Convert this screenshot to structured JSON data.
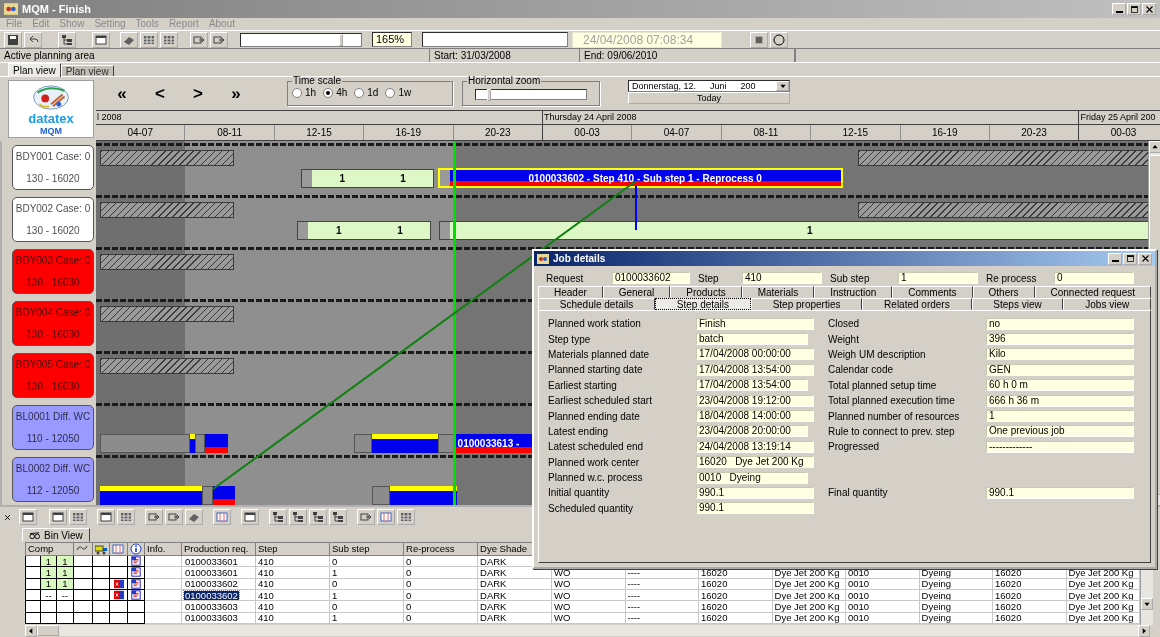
{
  "window": {
    "title": "MQM - Finish"
  },
  "menu": [
    "File",
    "Edit",
    "Show",
    "Setting",
    "Tools",
    "Report",
    "About"
  ],
  "toolbar": {
    "zoom_slider": {
      "level": 0.82
    },
    "zoom": "165%",
    "clock": "24/04/2008 07:08:34"
  },
  "info_bar": {
    "area": "Active planning area",
    "start": "Start: 31/03/2008",
    "end": "End: 09/06/2010"
  },
  "tabs": [
    {
      "label": "Plan view",
      "selected": true
    },
    {
      "label": "Plan view",
      "selected": false
    }
  ],
  "logo": {
    "name": "datatex",
    "product": "MQM"
  },
  "nav_buttons": [
    "«",
    "<",
    ">",
    "»"
  ],
  "time_scale": {
    "title": "Time scale",
    "options": [
      {
        "label": "1h",
        "selected": false
      },
      {
        "label": "4h",
        "selected": true
      },
      {
        "label": "1d",
        "selected": false
      },
      {
        "label": "1w",
        "selected": false
      }
    ]
  },
  "horizontal_zoom": {
    "title": "Horizontal zoom",
    "level": 0.1
  },
  "date_picker": {
    "parts": [
      "Donnerstag, 12.",
      "Juni",
      "200"
    ]
  },
  "today_button": "Today",
  "timeline": {
    "days": [
      {
        "label": "l 2008",
        "slots": [
          "04-07",
          "08-11",
          "12-15",
          "16-19",
          "20-23"
        ]
      },
      {
        "label": "Thursday 24 April 2008",
        "slots": [
          "00-03",
          "04-07",
          "08-11",
          "12-15",
          "16-19",
          "20-23"
        ]
      },
      {
        "label": "Friday 25 April 200",
        "slots": [
          "00-03"
        ]
      }
    ]
  },
  "resources": [
    {
      "name": "BDY001 Case: 0",
      "code": "130 - 16020",
      "color": "#ffffff",
      "bars": [
        {
          "kind": "hatch"
        },
        {
          "kind": "job",
          "labels": [
            "1",
            "1"
          ]
        },
        {
          "kind": "selected",
          "labels": [
            "0100033602 - Step 410 - Sub step 1 - Reprocess 0"
          ]
        },
        {
          "kind": "hatch"
        }
      ]
    },
    {
      "name": "BDY002 Case: 0",
      "code": "130 - 16020",
      "color": "#ffffff",
      "bars": [
        {
          "kind": "hatch"
        },
        {
          "kind": "job",
          "labels": [
            "1",
            "1"
          ]
        },
        {
          "kind": "job",
          "labels": [
            "1"
          ]
        },
        {
          "kind": "hatch"
        }
      ]
    },
    {
      "name": "BDY003 Case: 0",
      "code": "130 - 16030",
      "color": "#ff0000",
      "bars": [
        {
          "kind": "hatch"
        }
      ]
    },
    {
      "name": "BDY004 Case: 0",
      "code": "130 - 16030",
      "color": "#ff0000",
      "bars": [
        {
          "kind": "hatch"
        }
      ]
    },
    {
      "name": "BDY005 Case: 0",
      "code": "130 - 16030",
      "color": "#ff0000",
      "bars": [
        {
          "kind": "hatch"
        }
      ]
    },
    {
      "name": "BL0001 Diff. WC",
      "code": "110 - 12050",
      "color": "#9999ff",
      "bars": [
        {
          "kind": "idle"
        },
        {
          "kind": "run"
        },
        {
          "kind": "idle"
        },
        {
          "kind": "done"
        },
        {
          "kind": "idle"
        },
        {
          "kind": "run"
        },
        {
          "kind": "idle"
        },
        {
          "kind": "done",
          "labels": [
            "0100033613 -"
          ]
        }
      ]
    },
    {
      "name": "BL0002 Diff. WC",
      "code": "112 - 12050",
      "color": "#9999ff",
      "bars": [
        {
          "kind": "run"
        },
        {
          "kind": "idle"
        },
        {
          "kind": "done"
        },
        {
          "kind": "idle"
        },
        {
          "kind": "run"
        }
      ]
    }
  ],
  "bin_view": {
    "tab": "Bin View",
    "comp_header": "Comp",
    "info_header": "Info.",
    "columns": [
      "Production req.",
      "Step",
      "Sub step",
      "Re-process",
      "Dye Shade"
    ],
    "rows": [
      {
        "comp": [
          "1",
          "1"
        ],
        "complete": true,
        "marked": false,
        "noted": true,
        "selected": false,
        "cells": [
          "0100033601",
          "410",
          "0",
          "0",
          "DARK"
        ]
      },
      {
        "comp": [
          "1",
          "1"
        ],
        "complete": true,
        "marked": false,
        "noted": true,
        "selected": false,
        "cells": [
          "0100033601",
          "410",
          "1",
          "0",
          "DARK",
          "WO",
          "----",
          "16020",
          "Dye Jet 200 Kg",
          "0010",
          "Dyeing",
          "16020",
          "Dye Jet 200 Kg"
        ]
      },
      {
        "comp": [
          "1",
          "1"
        ],
        "complete": true,
        "marked": true,
        "noted": true,
        "selected": false,
        "cells": [
          "0100033602",
          "410",
          "0",
          "0",
          "DARK",
          "WO",
          "----",
          "16020",
          "Dye Jet 200 Kg",
          "0010",
          "Dyeing",
          "16020",
          "Dye Jet 200 Kg"
        ]
      },
      {
        "comp": [
          "--",
          "--"
        ],
        "complete": false,
        "marked": true,
        "noted": true,
        "selected": true,
        "cells": [
          "0100033602",
          "410",
          "1",
          "0",
          "DARK",
          "WO",
          "----",
          "16020",
          "Dye Jet 200 Kg",
          "0010",
          "Dyeing",
          "16020",
          "Dye Jet 200 Kg"
        ]
      },
      {
        "complete": false,
        "marked": false,
        "noted": false,
        "selected": false,
        "cells": [
          "0100033603",
          "410",
          "0",
          "0",
          "DARK",
          "WO",
          "----",
          "16020",
          "Dye Jet 200 Kg",
          "0010",
          "Dyeing",
          "16020",
          "Dye Jet 200 Kg"
        ]
      },
      {
        "complete": false,
        "marked": false,
        "noted": false,
        "selected": false,
        "cells": [
          "0100033603",
          "410",
          "1",
          "0",
          "DARK",
          "WO",
          "----",
          "16020",
          "Dye Jet 200 Kg",
          "0010",
          "Dyeing",
          "16020",
          "Dye Jet 200 Kg"
        ]
      }
    ]
  },
  "job_details": {
    "title": "Job details",
    "header": [
      {
        "label": "Request",
        "value": "0100033602"
      },
      {
        "label": "Step",
        "value": "410"
      },
      {
        "label": "Sub step",
        "value": "1"
      },
      {
        "label": "Re process",
        "value": "0"
      }
    ],
    "tab_rows": [
      [
        {
          "label": "Header",
          "selected": false
        },
        {
          "label": "General",
          "selected": false
        },
        {
          "label": "Products",
          "selected": false
        },
        {
          "label": "Materials",
          "selected": false
        },
        {
          "label": "Instruction",
          "selected": false
        },
        {
          "label": "Comments",
          "selected": false
        },
        {
          "label": "Others",
          "selected": false
        },
        {
          "label": "Connected request",
          "selected": false
        }
      ],
      [
        {
          "label": "Schedule details",
          "selected": false
        },
        {
          "label": "Step details",
          "selected": true
        },
        {
          "label": "Step properties",
          "selected": false
        },
        {
          "label": "Related orders",
          "selected": false
        },
        {
          "label": "Steps view",
          "selected": false
        },
        {
          "label": "Jobs view",
          "selected": false
        }
      ]
    ],
    "fields": [
      {
        "left": {
          "label": "Planned work station",
          "value": "Finish"
        },
        "right": {
          "label": "Closed",
          "value": "no"
        }
      },
      {
        "left": {
          "label": "Step type",
          "value": "batch"
        },
        "right": {
          "label": "Weight",
          "value": "396"
        }
      },
      {
        "left": {
          "label": "Materials planned date",
          "value": "17/04/2008 00:00:00"
        },
        "right": {
          "label": "Weigh UM description",
          "value": "Kilo"
        }
      },
      {
        "left": {
          "label": "Planned starting date",
          "value": "17/04/2008 13:54:00"
        },
        "right": {
          "label": "Calendar code",
          "value": "GEN"
        }
      },
      {
        "left": {
          "label": "Earliest starting",
          "value": "17/04/2008 13:54:00"
        },
        "right": {
          "label": "Total planned setup time",
          "value": "60 h 0 m"
        }
      },
      {
        "left": {
          "label": "Earliest scheduled start",
          "value": "23/04/2008 19:12:00"
        },
        "right": {
          "label": "Total planned execution time",
          "value": "666 h 36 m"
        }
      },
      {
        "left": {
          "label": "Planned ending date",
          "value": "18/04/2008 14:00:00"
        },
        "right": {
          "label": "Planned number of resources",
          "value": "1"
        }
      },
      {
        "left": {
          "label": "Latest ending",
          "value": "23/04/2008 20:00:00"
        },
        "right": {
          "label": "Rule to connect to prev. step",
          "value": "One previous job"
        }
      },
      {
        "left": {
          "label": "Latest scheduled end",
          "value": "24/04/2008 13:19:14"
        },
        "right": {
          "label": "Progressed",
          "value": "-------------"
        }
      },
      {
        "left": {
          "label": "Planned work center",
          "value": "16020   Dye Jet 200 Kg"
        }
      },
      {
        "left": {
          "label": "Planned w.c. process",
          "value": "0010   Dyeing"
        }
      },
      {
        "left": {
          "label": "Initial quantity",
          "value": "990.1"
        },
        "right": {
          "label": "Final quantity",
          "value": "990.1"
        }
      },
      {
        "left": {
          "label": "Scheduled quantity",
          "value": "990.1"
        }
      }
    ]
  }
}
